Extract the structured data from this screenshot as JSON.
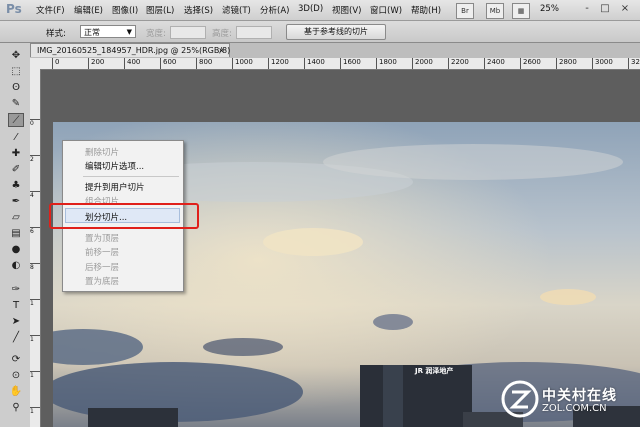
{
  "app": {
    "logo": "Ps"
  },
  "menubar": {
    "items": [
      "文件(F)",
      "编辑(E)",
      "图像(I)",
      "图层(L)",
      "选择(S)",
      "滤镜(T)",
      "分析(A)",
      "3D(D)",
      "视图(V)",
      "窗口(W)",
      "帮助(H)"
    ],
    "right_buttons": [
      "Br",
      "Mb"
    ],
    "zoom": "25%",
    "window_buttons": [
      "-",
      "□",
      "×"
    ]
  },
  "options": {
    "style_label": "样式:",
    "style_value": "正常",
    "width_label": "宽度:",
    "height_label": "高度:",
    "guides_button": "基于参考线的切片"
  },
  "document": {
    "tab_title": "IMG_20160525_184957_HDR.jpg @ 25%(RGB/8)",
    "close": "×"
  },
  "ruler": {
    "h_ticks": [
      "0",
      "200",
      "400",
      "600",
      "800",
      "1000",
      "1200",
      "1400",
      "1600",
      "1800",
      "2000",
      "2200",
      "2400",
      "2600",
      "2800",
      "3000",
      "3200"
    ],
    "v_ticks": [
      "0",
      "2",
      "4",
      "6",
      "8",
      "1",
      "1",
      "1",
      "1",
      "1",
      "2",
      "2",
      "2"
    ]
  },
  "context_menu": {
    "items": [
      {
        "label": "删除切片",
        "enabled": false
      },
      {
        "label": "编辑切片选项...",
        "enabled": true
      },
      {
        "label": "提升到用户切片",
        "enabled": true
      },
      {
        "label": "组合切片",
        "enabled": false
      },
      {
        "label": "划分切片...",
        "enabled": true,
        "highlighted": true
      },
      {
        "label": "置为顶层",
        "enabled": false
      },
      {
        "label": "前移一层",
        "enabled": false
      },
      {
        "label": "后移一层",
        "enabled": false
      },
      {
        "label": "置为底层",
        "enabled": false
      }
    ]
  },
  "photo": {
    "building_sign": "JR 润泽地产"
  },
  "watermark": {
    "line1": "中关村在线",
    "line2": "ZOL.COM.CN"
  },
  "colors": {
    "highlight_border": "#e0201a",
    "menu_hover": "#dfe8f6"
  }
}
